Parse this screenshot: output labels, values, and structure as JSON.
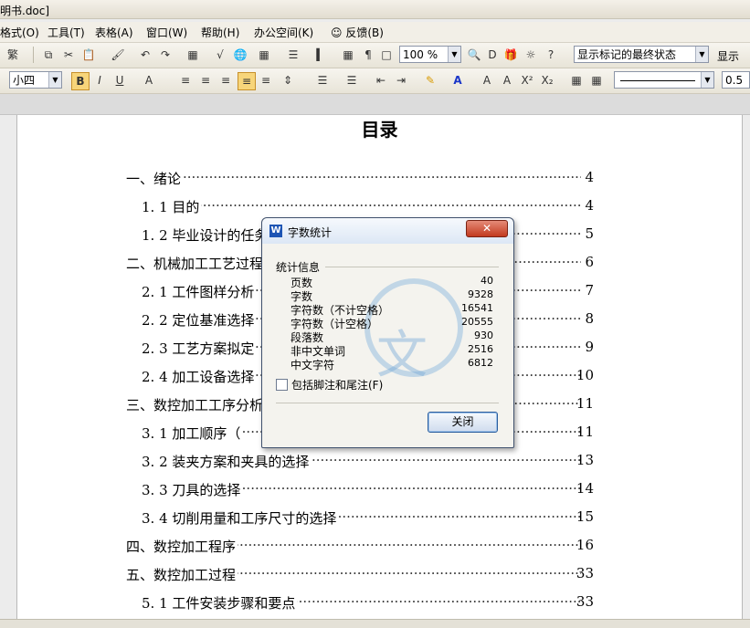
{
  "window": {
    "title": "明书.doc]"
  },
  "menu": [
    "格式(O)",
    "工具(T)",
    "表格(A)",
    "窗口(W)",
    "帮助(H)",
    "办公空间(K)",
    "反馈(B)"
  ],
  "toolbar1": {
    "trad_label": "繁",
    "zoom": "100 %",
    "track_status": "显示标记的最终状态",
    "show_label": "显示"
  },
  "toolbar2": {
    "font_size": "小四",
    "line_width": "0.5"
  },
  "document": {
    "title": "目录",
    "toc": [
      {
        "label": "一、绪论",
        "page": "4"
      },
      {
        "label": "1. 1   目的",
        "page": "4"
      },
      {
        "label": "1. 2   毕业设计的任务",
        "page": "5"
      },
      {
        "label": "二、机械加工工艺过程",
        "page": "6"
      },
      {
        "label": "2. 1   工件图样分析",
        "page": "7"
      },
      {
        "label": "2. 2   定位基准选择",
        "page": "8"
      },
      {
        "label": "2. 3   工艺方案拟定",
        "page": "9"
      },
      {
        "label": "2. 4   加工设备选择",
        "page": "10"
      },
      {
        "label": "三、数控加工工序分析",
        "page": "11"
      },
      {
        "label": "3. 1   加工顺序（",
        "page": "11"
      },
      {
        "label": "3. 2   装夹方案和夹具的选择",
        "page": "13"
      },
      {
        "label": "3. 3   刀具的选择",
        "page": "14"
      },
      {
        "label": "3. 4   切削用量和工序尺寸的选择",
        "page": "15"
      },
      {
        "label": "四、数控加工程序",
        "page": "16"
      },
      {
        "label": "五、数控加工过程",
        "page": "33"
      },
      {
        "label": "5. 1   工件安装步骤和要点",
        "page": "33"
      }
    ]
  },
  "dialog": {
    "title": "字数统计",
    "group_label": "统计信息",
    "stats": [
      {
        "key": "页数",
        "value": "40"
      },
      {
        "key": "字数",
        "value": "9328"
      },
      {
        "key": "字符数（不计空格）",
        "value": "16541"
      },
      {
        "key": "字符数（计空格）",
        "value": "20555"
      },
      {
        "key": "段落数",
        "value": "930"
      },
      {
        "key": "非中文单词",
        "value": "2516"
      },
      {
        "key": "中文字符",
        "value": "6812"
      }
    ],
    "checkbox_label": "包括脚注和尾注(F)",
    "close_label": "关闭",
    "watermark": "文"
  }
}
